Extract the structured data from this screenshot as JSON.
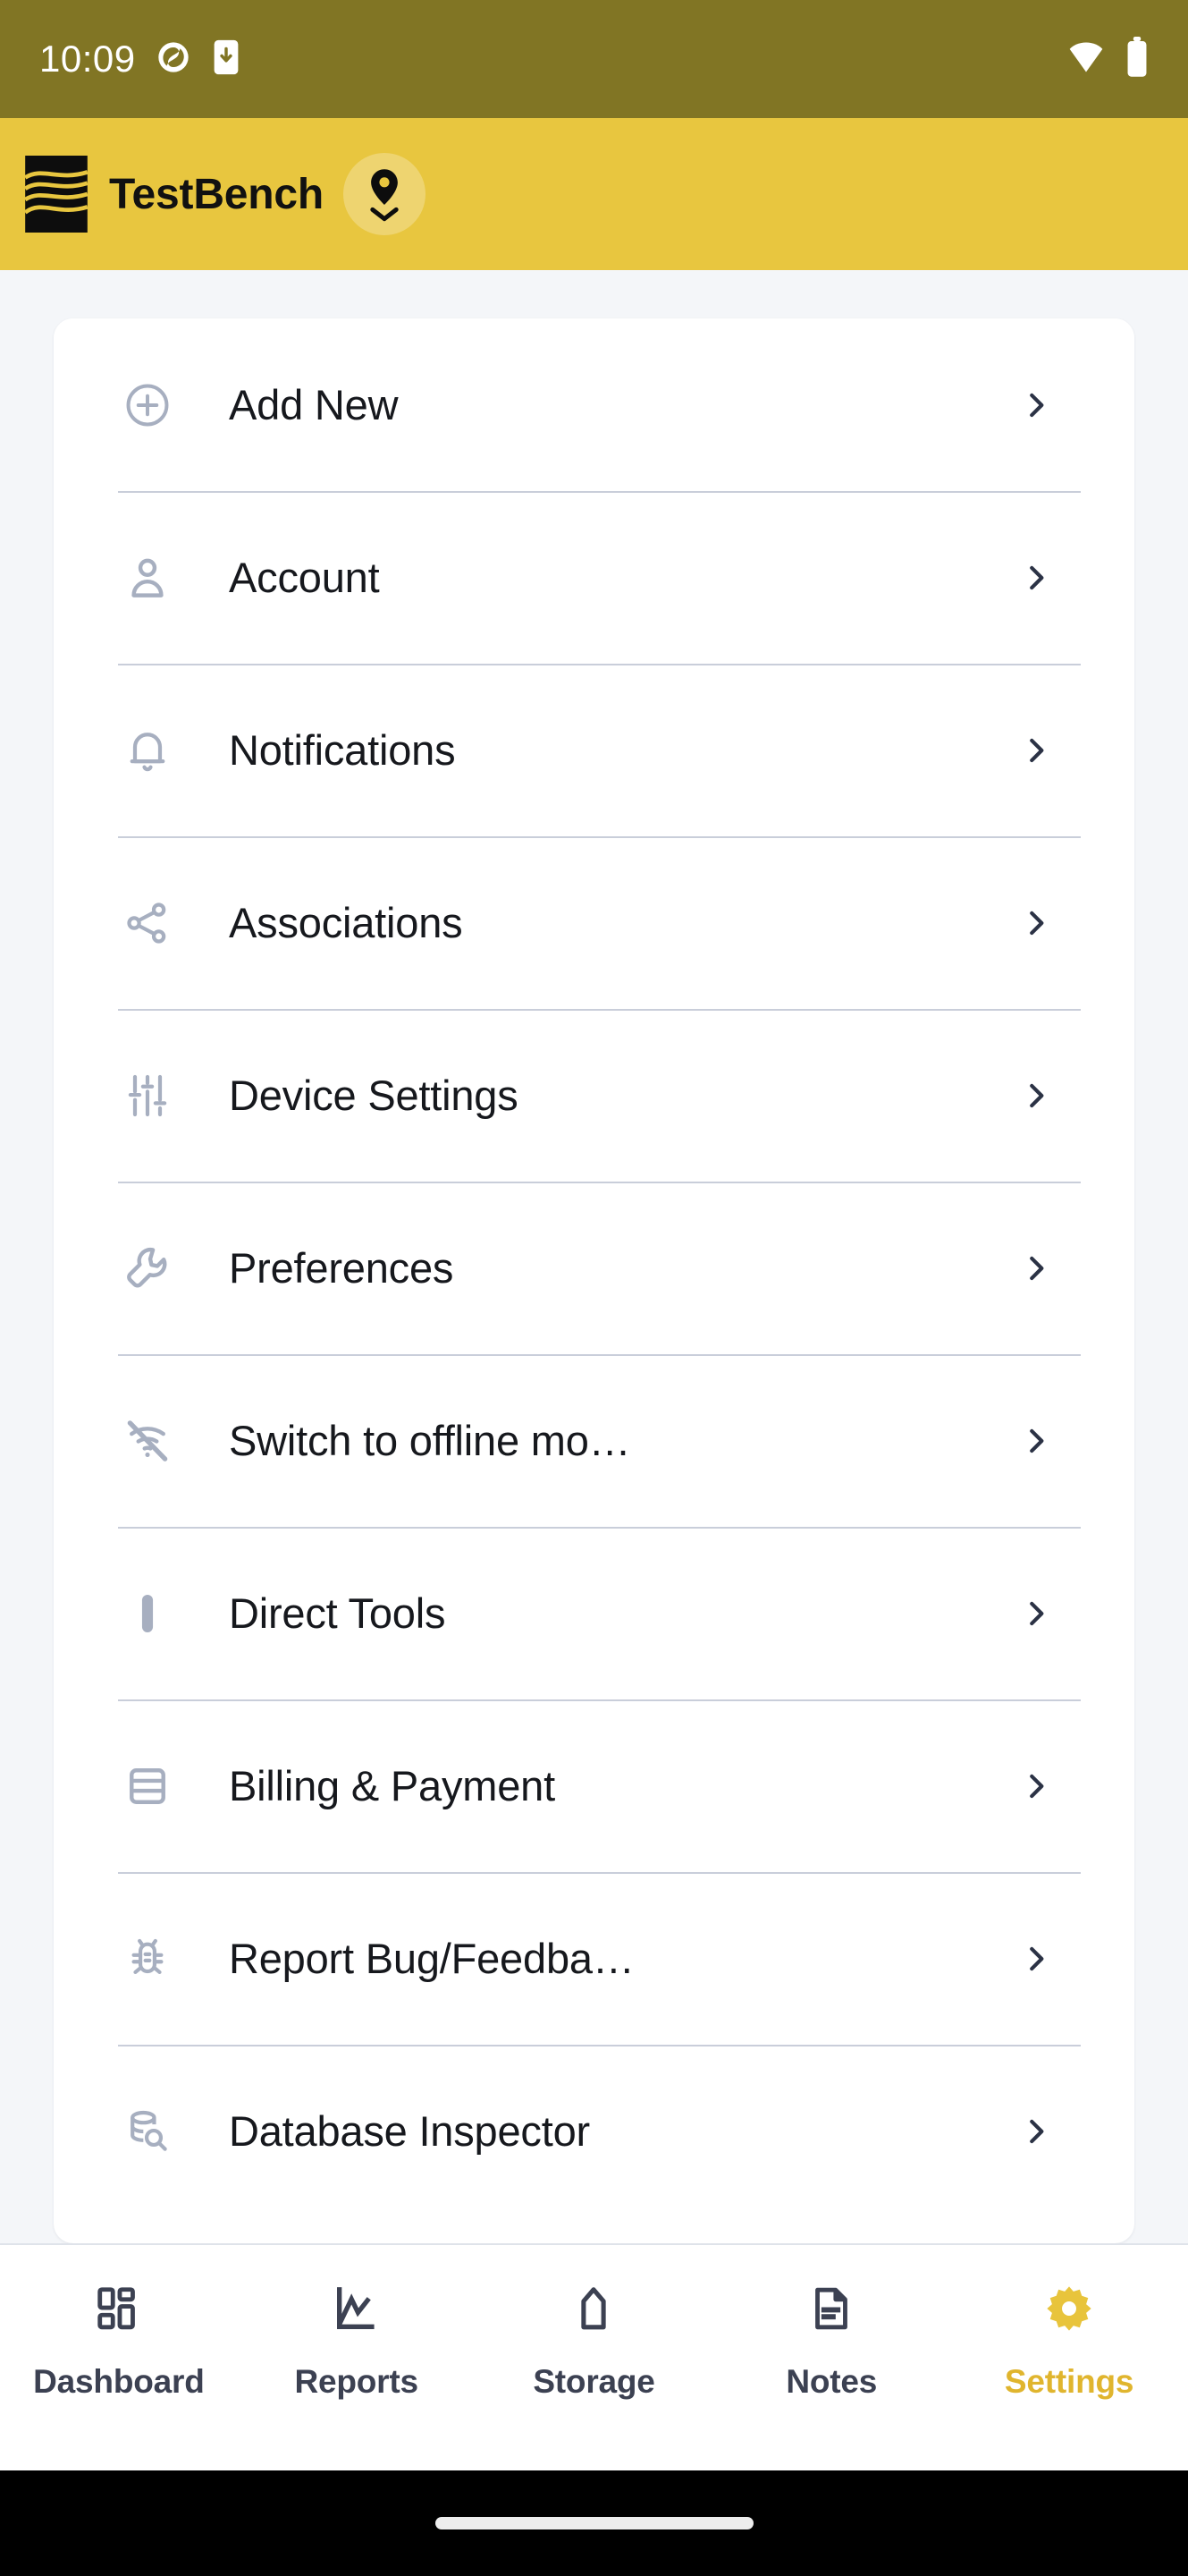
{
  "status_bar": {
    "time": "10:09",
    "left_icons": [
      "spiral-sync-icon",
      "phone-download-icon"
    ],
    "right_icons": [
      "wifi-icon",
      "battery-icon"
    ],
    "background_color": "#817524"
  },
  "app_bar": {
    "title": "TestBench",
    "logo": "testbench-wave-logo",
    "location_icon": "location-pin-chevron-icon",
    "background_color": "#E8C63F",
    "title_color": "#111111"
  },
  "settings_menu": {
    "items": [
      {
        "label": "Add New",
        "icon": "plus-circle-icon",
        "chevron": "chevron-right-icon"
      },
      {
        "label": "Account",
        "icon": "person-icon",
        "chevron": "chevron-right-icon"
      },
      {
        "label": "Notifications",
        "icon": "bell-icon",
        "chevron": "chevron-right-icon"
      },
      {
        "label": "Associations",
        "icon": "share-network-icon",
        "chevron": "chevron-right-icon"
      },
      {
        "label": "Device Settings",
        "icon": "sliders-tune-icon",
        "chevron": "chevron-right-icon"
      },
      {
        "label": "Preferences",
        "icon": "wrench-icon",
        "chevron": "chevron-right-icon"
      },
      {
        "label": "Switch to offline mo…",
        "icon": "wifi-off-icon",
        "chevron": "chevron-right-icon"
      },
      {
        "label": "Direct Tools",
        "icon": "probe-bar-icon",
        "chevron": "chevron-right-icon"
      },
      {
        "label": "Billing & Payment",
        "icon": "credit-card-icon",
        "chevron": "chevron-right-icon"
      },
      {
        "label": "Report Bug/Feedba…",
        "icon": "bug-icon",
        "chevron": "chevron-right-icon"
      },
      {
        "label": "Database Inspector",
        "icon": "database-search-icon",
        "chevron": "chevron-right-icon"
      }
    ],
    "icon_color": "#A7AFC0",
    "label_color": "#16181D",
    "divider_color": "#C9CEDA"
  },
  "bottom_nav": {
    "active_color": "#E8C43C",
    "inactive_color": "#3C4152",
    "items": [
      {
        "label": "Dashboard",
        "icon": "dashboard-grid-icon",
        "active": false
      },
      {
        "label": "Reports",
        "icon": "line-chart-icon",
        "active": false
      },
      {
        "label": "Storage",
        "icon": "silo-tank-icon",
        "active": false
      },
      {
        "label": "Notes",
        "icon": "document-icon",
        "active": false
      },
      {
        "label": "Settings",
        "icon": "gear-icon",
        "active": true
      }
    ]
  },
  "gesture_bar": {
    "handle": "home-indicator"
  }
}
